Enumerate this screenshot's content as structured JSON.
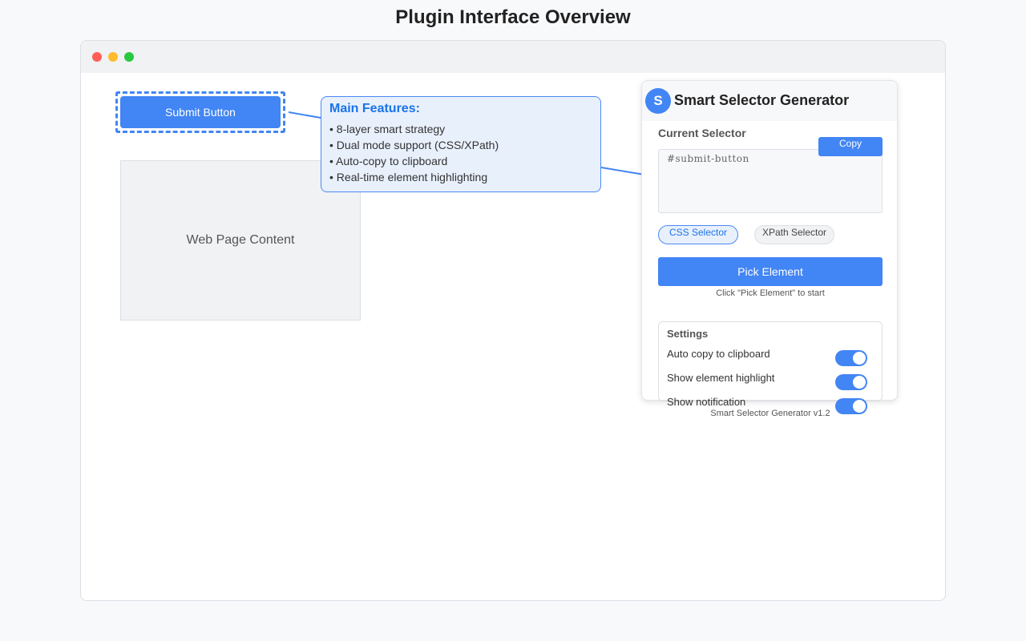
{
  "page": {
    "title": "Plugin Interface Overview"
  },
  "demo": {
    "submit_button_label": "Submit Button",
    "web_content_label": "Web Page Content"
  },
  "features": {
    "title": "Main Features:",
    "items": [
      "• 8-layer smart strategy",
      "• Dual mode support (CSS/XPath)",
      "• Auto-copy to clipboard",
      "• Real-time element highlighting"
    ]
  },
  "panel": {
    "logo_letter": "S",
    "title": "Smart Selector Generator",
    "current_selector_label": "Current Selector",
    "selector_value": "#submit-button",
    "copy_label": "Copy",
    "modes": {
      "css": "CSS Selector",
      "xpath": "XPath Selector",
      "active": "css"
    },
    "pick_label": "Pick Element",
    "pick_hint": "Click \"Pick Element\" to start",
    "settings": {
      "title": "Settings",
      "items": [
        {
          "label": "Auto copy to clipboard",
          "enabled": true
        },
        {
          "label": "Show element highlight",
          "enabled": true
        },
        {
          "label": "Show notification",
          "enabled": true
        }
      ]
    },
    "version": "Smart Selector Generator v1.2"
  },
  "colors": {
    "accent": "#4285f4",
    "accent_dark": "#1a73e8",
    "callout_bg": "#e8f0fc",
    "window_red": "#ff5f57",
    "window_yellow": "#febc2e",
    "window_green": "#28c840"
  }
}
